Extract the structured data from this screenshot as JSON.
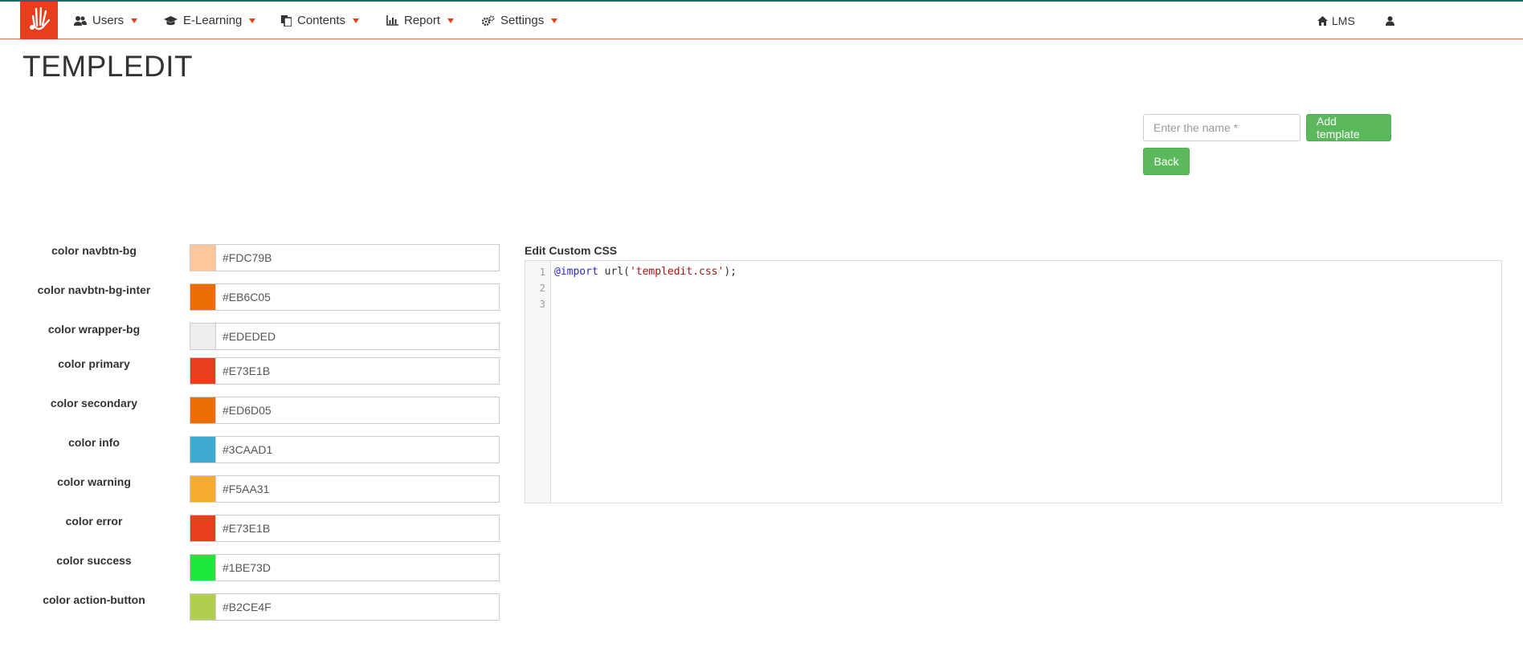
{
  "colors": {
    "brand": "#E73E1B",
    "button_green": "#5CB85C",
    "nav_border_top": "#1E6B63",
    "nav_border_bottom": "#E8734A"
  },
  "nav": {
    "logo_icon": "hand-icon",
    "items": [
      {
        "label": "Users",
        "icon": "users-icon"
      },
      {
        "label": "E-Learning",
        "icon": "graduation-cap-icon"
      },
      {
        "label": "Contents",
        "icon": "files-icon"
      },
      {
        "label": "Report",
        "icon": "bar-chart-icon"
      },
      {
        "label": "Settings",
        "icon": "gears-icon"
      }
    ],
    "right": {
      "lms_label": "LMS",
      "lms_icon": "home-icon",
      "user_icon": "user-icon"
    }
  },
  "page": {
    "title": "TEMPLEDIT"
  },
  "template": {
    "name_placeholder": "Enter the name *",
    "add_label": "Add template",
    "back_label": "Back"
  },
  "color_fields": [
    {
      "label": "color navbtn-bg",
      "value": "#FDC79B",
      "swatch": "#FDC79B"
    },
    {
      "label": "color navbtn-bg-inter",
      "value": "#EB6C05",
      "swatch": "#EB6C05"
    },
    {
      "label": "color wrapper-bg",
      "value": "#EDEDED",
      "swatch": "#EDEDED"
    },
    {
      "label": "color primary",
      "value": "#E73E1B",
      "swatch": "#E73E1B"
    },
    {
      "label": "color secondary",
      "value": "#ED6D05",
      "swatch": "#ED6D05"
    },
    {
      "label": "color info",
      "value": "#3CAAD1",
      "swatch": "#3CAAD1"
    },
    {
      "label": "color warning",
      "value": "#F5AA31",
      "swatch": "#F5AA31"
    },
    {
      "label": "color error",
      "value": "#E73E1B",
      "swatch": "#E73E1B"
    },
    {
      "label": "color success",
      "value": "#1BE73D",
      "swatch": "#1BE73D"
    },
    {
      "label": "color action-button",
      "value": "#B2CE4F",
      "swatch": "#B2CE4F"
    }
  ],
  "editor": {
    "title": "Edit Custom CSS",
    "line_numbers": [
      "1",
      "2",
      "3"
    ],
    "code_keyword": "@import",
    "code_func": " url(",
    "code_string": "'templedit.css'",
    "code_end": ");"
  }
}
